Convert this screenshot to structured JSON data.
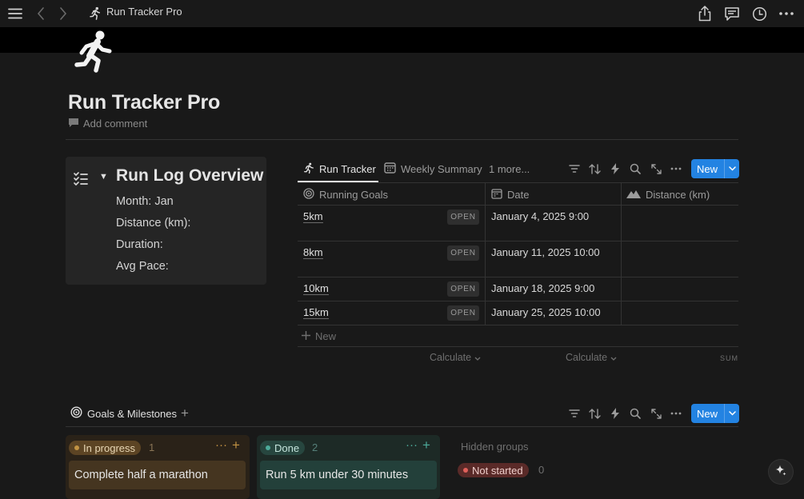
{
  "topbar": {
    "title": "Run Tracker Pro",
    "icons": [
      "menu-icon",
      "back-icon",
      "forward-icon",
      "share-icon",
      "comments-icon",
      "history-icon",
      "more-icon"
    ]
  },
  "page": {
    "title": "Run Tracker Pro",
    "add_comment": "Add comment"
  },
  "callout": {
    "heading": "Run Log Overview",
    "toggle": "▼",
    "lines": [
      "Month: Jan",
      "Distance (km):",
      "Duration:",
      "Avg Pace:"
    ]
  },
  "database": {
    "tabs": [
      {
        "label": "Run Tracker",
        "icon": "runner-icon",
        "active": true
      },
      {
        "label": "Weekly Summary",
        "icon": "calendar-icon",
        "active": false
      },
      {
        "label": "1 more...",
        "icon": "",
        "active": false
      }
    ],
    "new_label": "New",
    "columns": [
      {
        "label": "Running Goals",
        "icon": "target-icon"
      },
      {
        "label": "Date",
        "icon": "calendar-icon"
      },
      {
        "label": "Distance (km)",
        "icon": "mountain-icon"
      }
    ],
    "rows": [
      {
        "name": "5km",
        "open": "OPEN",
        "date": "January 4, 2025 9:00",
        "distance": ""
      },
      {
        "name": "8km",
        "open": "OPEN",
        "date": "January 11, 2025 10:00",
        "distance": ""
      },
      {
        "name": "10km",
        "open": "OPEN",
        "date": "January 18, 2025 9:00",
        "distance": ""
      },
      {
        "name": "15km",
        "open": "OPEN",
        "date": "January 25, 2025 10:00",
        "distance": ""
      }
    ],
    "new_row": "New",
    "calculate": "Calculate",
    "sum": "SUM"
  },
  "board": {
    "tab_label": "Goals & Milestones",
    "new_label": "New",
    "groups": [
      {
        "label": "In progress",
        "count": "1",
        "card": "Complete half a marathon",
        "color": "#c29343"
      },
      {
        "label": "Done",
        "count": "2",
        "card": "Run 5 km under 30 minutes",
        "color": "#4dab9a"
      }
    ],
    "hidden_groups": "Hidden groups",
    "hidden": [
      {
        "label": "Not started",
        "count": "0",
        "color": "#e0605a"
      }
    ]
  }
}
